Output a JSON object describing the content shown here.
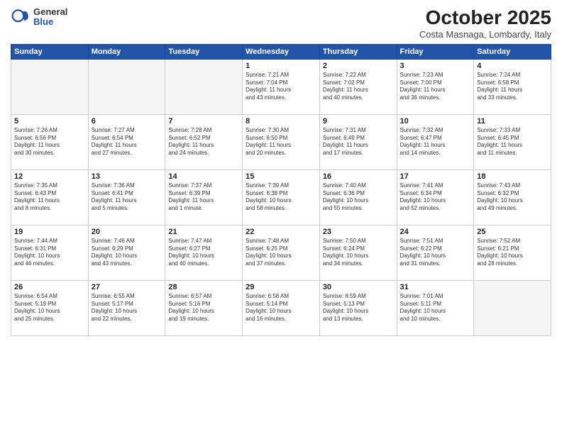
{
  "logo": {
    "general": "General",
    "blue": "Blue"
  },
  "title": "October 2025",
  "subtitle": "Costa Masnaga, Lombardy, Italy",
  "days": [
    "Sunday",
    "Monday",
    "Tuesday",
    "Wednesday",
    "Thursday",
    "Friday",
    "Saturday"
  ],
  "weeks": [
    [
      {
        "day": "",
        "info": ""
      },
      {
        "day": "",
        "info": ""
      },
      {
        "day": "",
        "info": ""
      },
      {
        "day": "1",
        "info": "Sunrise: 7:21 AM\nSunset: 7:04 PM\nDaylight: 11 hours\nand 43 minutes."
      },
      {
        "day": "2",
        "info": "Sunrise: 7:22 AM\nSunset: 7:02 PM\nDaylight: 11 hours\nand 40 minutes."
      },
      {
        "day": "3",
        "info": "Sunrise: 7:23 AM\nSunset: 7:00 PM\nDaylight: 11 hours\nand 36 minutes."
      },
      {
        "day": "4",
        "info": "Sunrise: 7:24 AM\nSunset: 6:58 PM\nDaylight: 11 hours\nand 33 minutes."
      }
    ],
    [
      {
        "day": "5",
        "info": "Sunrise: 7:26 AM\nSunset: 6:56 PM\nDaylight: 11 hours\nand 30 minutes."
      },
      {
        "day": "6",
        "info": "Sunrise: 7:27 AM\nSunset: 6:54 PM\nDaylight: 11 hours\nand 27 minutes."
      },
      {
        "day": "7",
        "info": "Sunrise: 7:28 AM\nSunset: 6:52 PM\nDaylight: 11 hours\nand 24 minutes."
      },
      {
        "day": "8",
        "info": "Sunrise: 7:30 AM\nSunset: 6:50 PM\nDaylight: 11 hours\nand 20 minutes."
      },
      {
        "day": "9",
        "info": "Sunrise: 7:31 AM\nSunset: 6:49 PM\nDaylight: 11 hours\nand 17 minutes."
      },
      {
        "day": "10",
        "info": "Sunrise: 7:32 AM\nSunset: 6:47 PM\nDaylight: 11 hours\nand 14 minutes."
      },
      {
        "day": "11",
        "info": "Sunrise: 7:33 AM\nSunset: 6:45 PM\nDaylight: 11 hours\nand 11 minutes."
      }
    ],
    [
      {
        "day": "12",
        "info": "Sunrise: 7:35 AM\nSunset: 6:43 PM\nDaylight: 11 hours\nand 8 minutes."
      },
      {
        "day": "13",
        "info": "Sunrise: 7:36 AM\nSunset: 6:41 PM\nDaylight: 11 hours\nand 5 minutes."
      },
      {
        "day": "14",
        "info": "Sunrise: 7:37 AM\nSunset: 6:39 PM\nDaylight: 11 hours\nand 1 minute."
      },
      {
        "day": "15",
        "info": "Sunrise: 7:39 AM\nSunset: 6:38 PM\nDaylight: 10 hours\nand 58 minutes."
      },
      {
        "day": "16",
        "info": "Sunrise: 7:40 AM\nSunset: 6:36 PM\nDaylight: 10 hours\nand 55 minutes."
      },
      {
        "day": "17",
        "info": "Sunrise: 7:41 AM\nSunset: 6:34 PM\nDaylight: 10 hours\nand 52 minutes."
      },
      {
        "day": "18",
        "info": "Sunrise: 7:43 AM\nSunset: 6:32 PM\nDaylight: 10 hours\nand 49 minutes."
      }
    ],
    [
      {
        "day": "19",
        "info": "Sunrise: 7:44 AM\nSunset: 6:31 PM\nDaylight: 10 hours\nand 46 minutes."
      },
      {
        "day": "20",
        "info": "Sunrise: 7:46 AM\nSunset: 6:29 PM\nDaylight: 10 hours\nand 43 minutes."
      },
      {
        "day": "21",
        "info": "Sunrise: 7:47 AM\nSunset: 6:27 PM\nDaylight: 10 hours\nand 40 minutes."
      },
      {
        "day": "22",
        "info": "Sunrise: 7:48 AM\nSunset: 6:25 PM\nDaylight: 10 hours\nand 37 minutes."
      },
      {
        "day": "23",
        "info": "Sunrise: 7:50 AM\nSunset: 6:24 PM\nDaylight: 10 hours\nand 34 minutes."
      },
      {
        "day": "24",
        "info": "Sunrise: 7:51 AM\nSunset: 6:22 PM\nDaylight: 10 hours\nand 31 minutes."
      },
      {
        "day": "25",
        "info": "Sunrise: 7:52 AM\nSunset: 6:21 PM\nDaylight: 10 hours\nand 28 minutes."
      }
    ],
    [
      {
        "day": "26",
        "info": "Sunrise: 6:54 AM\nSunset: 5:19 PM\nDaylight: 10 hours\nand 25 minutes."
      },
      {
        "day": "27",
        "info": "Sunrise: 6:55 AM\nSunset: 5:17 PM\nDaylight: 10 hours\nand 22 minutes."
      },
      {
        "day": "28",
        "info": "Sunrise: 6:57 AM\nSunset: 5:16 PM\nDaylight: 10 hours\nand 19 minutes."
      },
      {
        "day": "29",
        "info": "Sunrise: 6:58 AM\nSunset: 5:14 PM\nDaylight: 10 hours\nand 16 minutes."
      },
      {
        "day": "30",
        "info": "Sunrise: 6:59 AM\nSunset: 5:13 PM\nDaylight: 10 hours\nand 13 minutes."
      },
      {
        "day": "31",
        "info": "Sunrise: 7:01 AM\nSunset: 5:11 PM\nDaylight: 10 hours\nand 10 minutes."
      },
      {
        "day": "",
        "info": ""
      }
    ]
  ]
}
